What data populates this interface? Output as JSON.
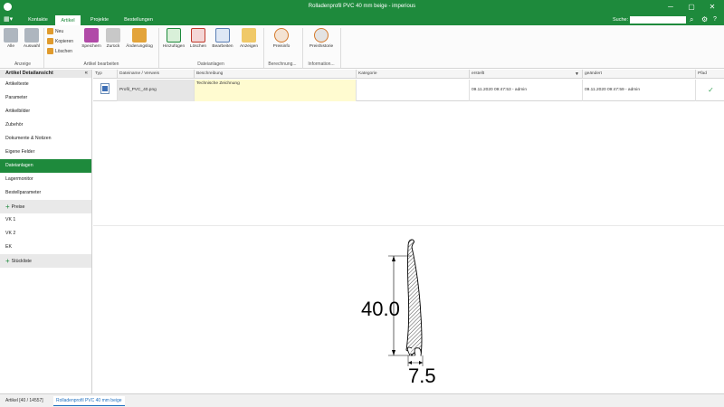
{
  "window": {
    "title": "Rolladenprofil PVC 40 mm beige - imperious",
    "minimize": "─",
    "maximize": "▢",
    "close": "✕"
  },
  "menu": {
    "tabs": [
      "Kontakte",
      "Artikel",
      "Projekte",
      "Bestellungen"
    ],
    "active_tab": "Artikel",
    "search_label": "Suche:",
    "search_value": ""
  },
  "ribbon": {
    "groups": {
      "anzeige": "Anzeige",
      "artikel_bearbeiten": "Artikel bearbeiten",
      "dateianlagen": "Dateianlagen",
      "berechnung": "Berechnung...",
      "information": "Information..."
    },
    "buttons": {
      "alle": "Alle",
      "auswahl": "Auswahl",
      "neu": "Neu",
      "kopieren": "Kopieren",
      "loeschen_small": "Löschen",
      "speichern": "Speichern",
      "zurueck": "Zurück",
      "aenderungslog": "Änderungslog",
      "hinzufuegen": "Hinzufügen",
      "loeschen": "Löschen",
      "bearbeiten": "Bearbeiten",
      "anzeigen": "Anzeigen",
      "preisinfo": "Preisinfo",
      "preishistorie": "Preishistorie"
    }
  },
  "sidebar": {
    "header": "Artikel Detailansicht",
    "collapse": "«",
    "items": [
      "Artikeltexte",
      "Parameter",
      "Artikelbilder",
      "Zubehör",
      "Dokumente & Notizen",
      "Eigene Felder",
      "Dateianlagen",
      "Lagermonitor",
      "Bestellparameter"
    ],
    "active": "Dateianlagen",
    "group_preise": "Preise",
    "price_items": [
      "VK 1",
      "VK 2",
      "EK"
    ],
    "group_stueckliste": "Stückliste"
  },
  "grid": {
    "columns": [
      "Typ",
      "Dateiname / Verwei­s",
      "Beschreibung",
      "Kategorie",
      "erstellt",
      "geändert",
      "Pfad"
    ],
    "row": {
      "filename": "Profil_PVC_40.png",
      "description": "Technische Zeichnung",
      "category": "",
      "created": "09.11.2020 09:47:53 - admin",
      "changed": "09.11.2020 09:47:59 - admin",
      "path_check": "✓"
    }
  },
  "preview": {
    "height_label": "40.0",
    "width_label": "7.5"
  },
  "statusbar": {
    "tab1": "Artikel [40 / 14557]",
    "tab2": "Rolladenprofil PVC 40 mm beige"
  },
  "colors": {
    "accent": "#1e8a3c",
    "highlight_yellow": "#fffbd0",
    "link_blue": "#1e6fbf"
  }
}
